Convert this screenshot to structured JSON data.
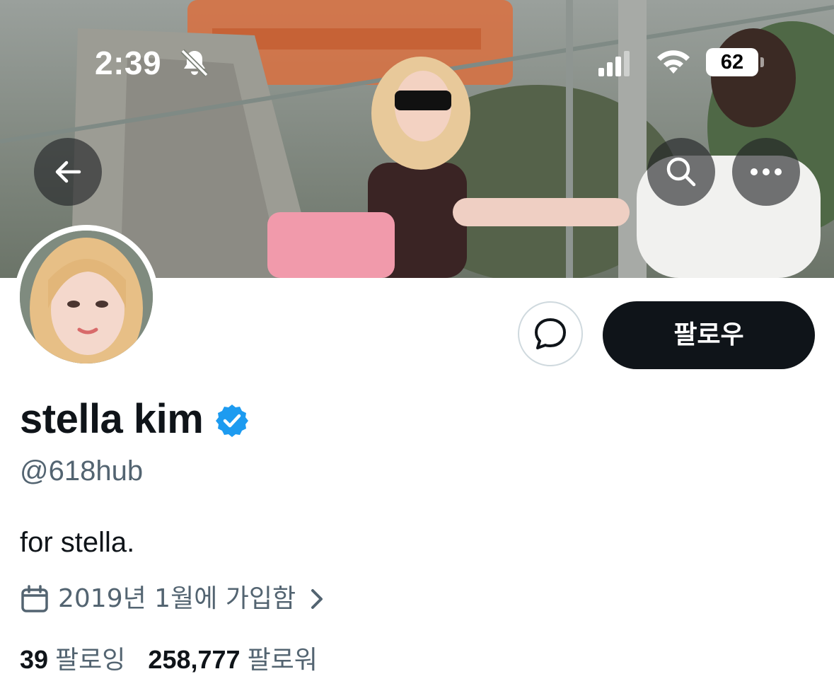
{
  "status_bar": {
    "time": "2:39",
    "battery": "62",
    "icons": [
      "bell-slash-icon",
      "signal-icon",
      "wifi-icon",
      "battery-icon"
    ]
  },
  "banner": {
    "buttons": [
      "back-arrow-icon",
      "search-icon",
      "more-dots-icon"
    ]
  },
  "actions": {
    "message_icon": "message-bubble-icon",
    "follow_label": "팔로우"
  },
  "profile": {
    "display_name": "stella kim",
    "verified": true,
    "handle": "@618hub",
    "bio": "for stella.",
    "joined": "2019년 1월에 가입함",
    "following_count": "39",
    "following_label": "팔로잉",
    "followers_count": "258,777",
    "followers_label": "팔로워"
  },
  "colors": {
    "primary_text": "#0f1419",
    "secondary_text": "#536471",
    "verified_blue": "#1d9bf0",
    "follow_button_bg": "#0f1419",
    "border": "#cfd9de"
  }
}
